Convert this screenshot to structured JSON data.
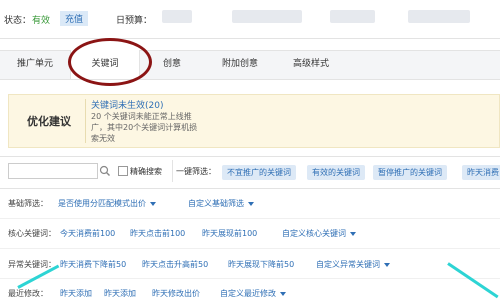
{
  "status": {
    "label": "状态：",
    "value": "有效",
    "button": "充值"
  },
  "budget": {
    "label": "日预算："
  },
  "tabs": [
    "推广单元",
    "关键词",
    "创意",
    "附加创意",
    "高级样式"
  ],
  "advice": {
    "title": "优化建议",
    "heading": "关键词未生效(20)",
    "line1": "20 个关键词未能正常上线推",
    "line2": "广，其中20个关键词计算机损",
    "line3": "索无效"
  },
  "search": {
    "placeholder": ""
  },
  "exact_search": "精确搜索",
  "filter_label": "一键筛选：",
  "filter_chips": [
    "不宜推广的关键词",
    "有效的关键词",
    "暂停推广的关键词",
    "昨天消费"
  ],
  "basic_filter": {
    "label": "基础筛选：",
    "links": [
      "是否使用分匹配模式出价",
      "自定义基础筛选"
    ]
  },
  "core_keywords": {
    "label": "核心关键词：",
    "links": [
      "今天消费前100",
      "昨天点击前100",
      "昨天展现前100",
      "自定义核心关键词"
    ]
  },
  "abnormal_keywords": {
    "label": "异常关键词：",
    "links": [
      "昨天消费下降前50",
      "昨天点击升高前50",
      "昨天展现下降前50",
      "自定义异常关键词"
    ]
  },
  "recent_mods": {
    "label": "最近修改：",
    "links": [
      "昨天添加",
      "昨天添加",
      "昨天修改出价",
      "自定义最近修改"
    ]
  },
  "colors": {
    "accent": "#2f6fb5",
    "status_green": "#3a9a3a",
    "annotation_circle": "#8b1414",
    "advice_bg": "#fdf7e3"
  }
}
